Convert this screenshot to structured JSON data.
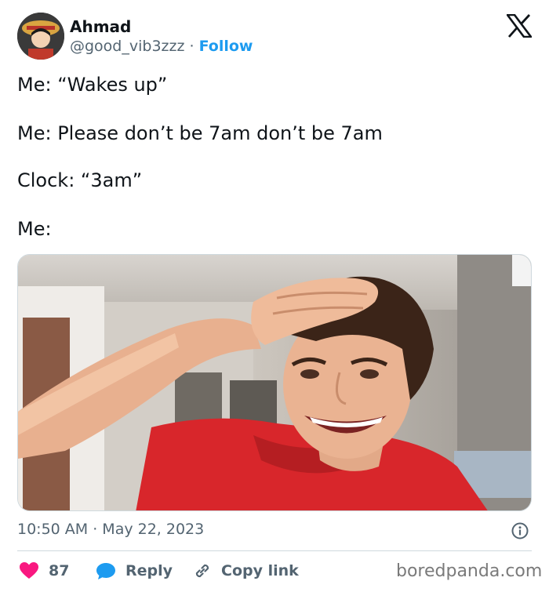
{
  "author": {
    "name": "Ahmad",
    "handle": "@good_vib3zzz",
    "separator": " · ",
    "follow_label": "Follow"
  },
  "tweet": {
    "lines": [
      "Me: “Wakes up”",
      "Me: Please don’t be 7am don’t be 7am",
      "Clock: “3am”",
      "Me:"
    ],
    "timestamp": "10:50 AM · May 22, 2023"
  },
  "actions": {
    "likes_count": "87",
    "reply_label": "Reply",
    "copy_link_label": "Copy link"
  },
  "watermark": "boredpanda.com",
  "icons": {
    "like": "heart-icon",
    "reply": "speech-bubble-icon",
    "copy": "link-icon",
    "info": "info-icon",
    "logo": "x-logo-icon"
  },
  "colors": {
    "accent": "#1d9bf0",
    "like": "#f91880",
    "reply": "#1d9bf0",
    "muted": "#536471",
    "text": "#0f1419"
  }
}
